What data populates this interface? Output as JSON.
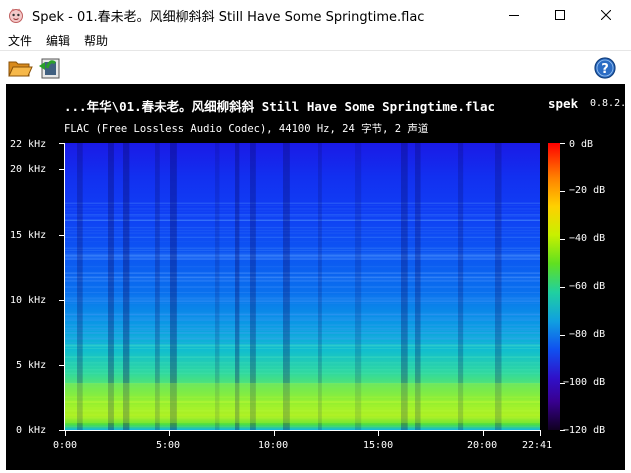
{
  "window": {
    "title": "Spek - 01.春未老。风细柳斜斜 Still Have Some Springtime.flac",
    "app_icon": "spek-app-icon",
    "controls": [
      "minimize-icon",
      "maximize-icon",
      "close-icon"
    ]
  },
  "menu": {
    "items": [
      {
        "label": "文件"
      },
      {
        "label": "编辑"
      },
      {
        "label": "帮助"
      }
    ]
  },
  "toolbar": {
    "buttons": [
      {
        "icon": "open-folder-icon"
      },
      {
        "icon": "save-icon"
      },
      {
        "icon": "help-icon"
      }
    ]
  },
  "spectrum": {
    "title": "...年华\\01.春未老。风细柳斜斜 Still Have Some Springtime.flac",
    "brand": "spek",
    "version": "0.8.2.3",
    "info": "FLAC (Free Lossless Audio Codec), 44100 Hz, 24 字节, 2 声道",
    "y_ticks": [
      "22 kHz",
      "20 kHz",
      "15 kHz",
      "10 kHz",
      "5 kHz",
      "0 kHz"
    ],
    "x_ticks": [
      "0:00",
      "5:00",
      "10:00",
      "15:00",
      "20:00",
      "22:41"
    ],
    "db_ticks": [
      "0 dB",
      "−20 dB",
      "−40 dB",
      "−60 dB",
      "−80 dB",
      "−100 dB",
      "−120 dB"
    ],
    "colors": {
      "background": "#000000",
      "low_freq": "#8ee830",
      "high_freq": "#1a1ae6",
      "db_top": "#ff0000",
      "db_bottom": "#100020"
    }
  }
}
